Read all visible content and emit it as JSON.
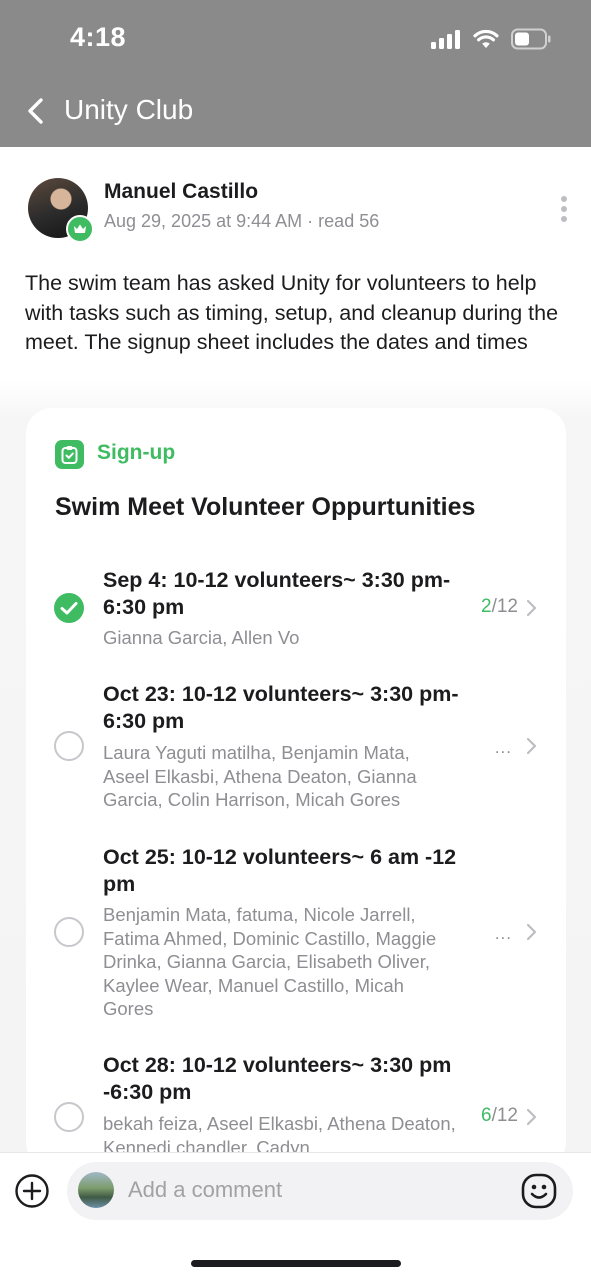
{
  "status_bar": {
    "time": "4:18"
  },
  "nav": {
    "title": "Unity Club"
  },
  "post": {
    "author": "Manuel Castillo",
    "date": "Aug 29, 2025 at 9:44 AM",
    "reads": "read 56",
    "body": "The swim team has asked Unity for volunteers to help with tasks such as timing, setup, and cleanup during the meet. The signup sheet includes the dates and times"
  },
  "signup": {
    "label": "Sign-up",
    "title": "Swim Meet Volunteer Oppurtunities",
    "slots": [
      {
        "title": "Sep 4: 10-12 volunteers~ 3:30 pm-6:30 pm",
        "names": "Gianna Garcia, Allen Vo",
        "signed_up": true,
        "filled": "2",
        "capacity": "/12",
        "more": ""
      },
      {
        "title": "Oct 23: 10-12 volunteers~ 3:30 pm-6:30 pm",
        "names": "Laura Yaguti matilha, Benjamin Mata, Aseel Elkasbi, Athena Deaton, Gianna Garcia, Colin Harrison, Micah Gores",
        "signed_up": false,
        "filled": "",
        "capacity": "",
        "more": "..."
      },
      {
        "title": "Oct 25: 10-12 volunteers~ 6 am -12 pm",
        "names": "Benjamin Mata, fatuma, Nicole Jarrell, Fatima Ahmed, Dominic Castillo, Maggie Drinka, Gianna Garcia, Elisabeth Oliver, Kaylee Wear, Manuel Castillo, Micah Gores",
        "signed_up": false,
        "filled": "",
        "capacity": "",
        "more": "..."
      },
      {
        "title": "Oct 28: 10-12 volunteers~ 3:30 pm -6:30 pm",
        "names": "bekah feiza, Aseel Elkasbi, Athena Deaton, Kennedi chandler, Cadyn,",
        "signed_up": false,
        "filled": "6",
        "capacity": "/12",
        "more": ""
      }
    ]
  },
  "comment": {
    "placeholder": "Add a comment"
  },
  "colors": {
    "accent_green": "#3fbb62",
    "header_gray": "#8a8a8a",
    "muted_text": "#8e8e93"
  }
}
